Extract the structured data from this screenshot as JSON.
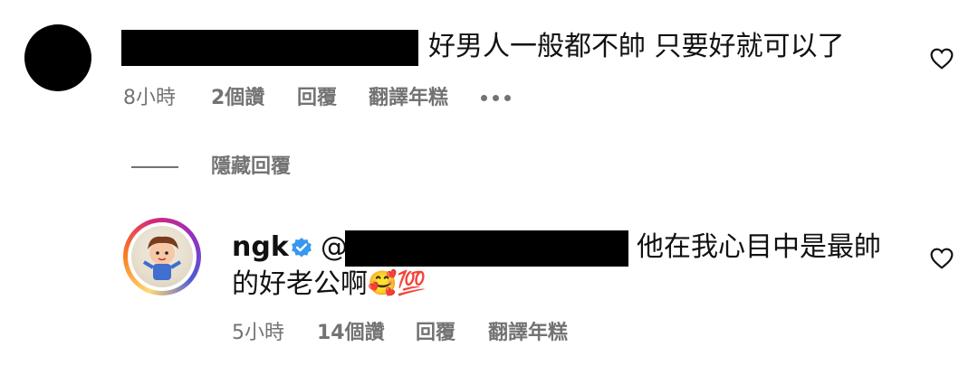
{
  "comment1": {
    "text": "好男人一般都不帥 只要好就可以了",
    "time": "8小時",
    "likes": "2個讚",
    "reply_label": "回覆",
    "translate_label": "翻譯年糕",
    "more_icon": "more-dots-icon",
    "like_icon": "heart-outline-icon"
  },
  "hide_replies_label": "隱藏回覆",
  "comment2": {
    "username": "ngk",
    "mention": "@",
    "text_line1": "他在我心目中是最帥",
    "text_line2": "的好老公啊",
    "emoji": "🥰💯",
    "time": "5小時",
    "likes": "14個讚",
    "reply_label": "回覆",
    "translate_label": "翻譯年糕",
    "verified_icon": "verified-badge-icon",
    "like_icon": "heart-outline-icon"
  },
  "colors": {
    "text": "#111111",
    "secondary": "#737373",
    "verified": "#3897f0"
  }
}
